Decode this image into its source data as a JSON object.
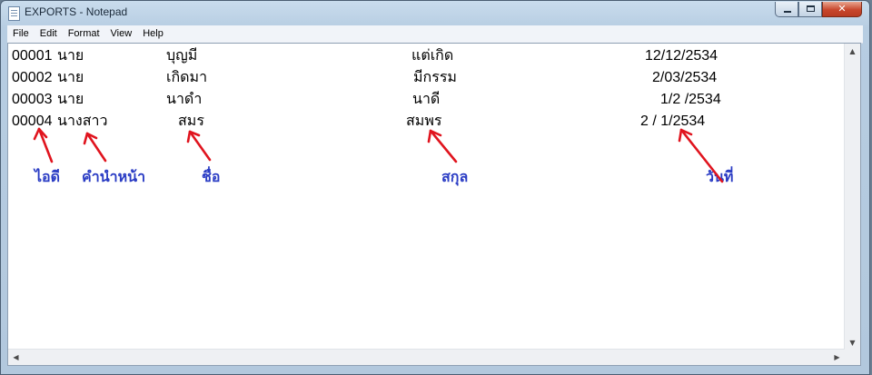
{
  "window": {
    "title": "EXPORTS - Notepad"
  },
  "icons": {
    "app": "notepad-icon",
    "minimize": "minimize-icon",
    "maximize": "maximize-icon",
    "close": "close-icon"
  },
  "menu": [
    "File",
    "Edit",
    "Format",
    "View",
    "Help"
  ],
  "rows": [
    {
      "id": "00001",
      "prefix": "นาย",
      "first": "บุญมี",
      "last": "แต่เกิด",
      "date": "12/12/2534"
    },
    {
      "id": "00002",
      "prefix": "นาย",
      "first": "เกิดมา",
      "last": "มีกรรม",
      "date": "2/03/2534"
    },
    {
      "id": "00003",
      "prefix": "นาย",
      "first": "นาดำ",
      "last": "นาดี",
      "date": "1/2 /2534"
    },
    {
      "id": "00004",
      "prefix": "นางสาว",
      "first": "สมร",
      "last": "สมพร",
      "date": "2 / 1/2534"
    }
  ],
  "annotations": {
    "id": "ไอดี",
    "prefix": "คำนำหน้า",
    "first": "ชื่อ",
    "last": "สกุล",
    "date": "วันที่"
  },
  "colors": {
    "annotation_text": "#2a3cc4",
    "arrow": "#e0141e"
  }
}
